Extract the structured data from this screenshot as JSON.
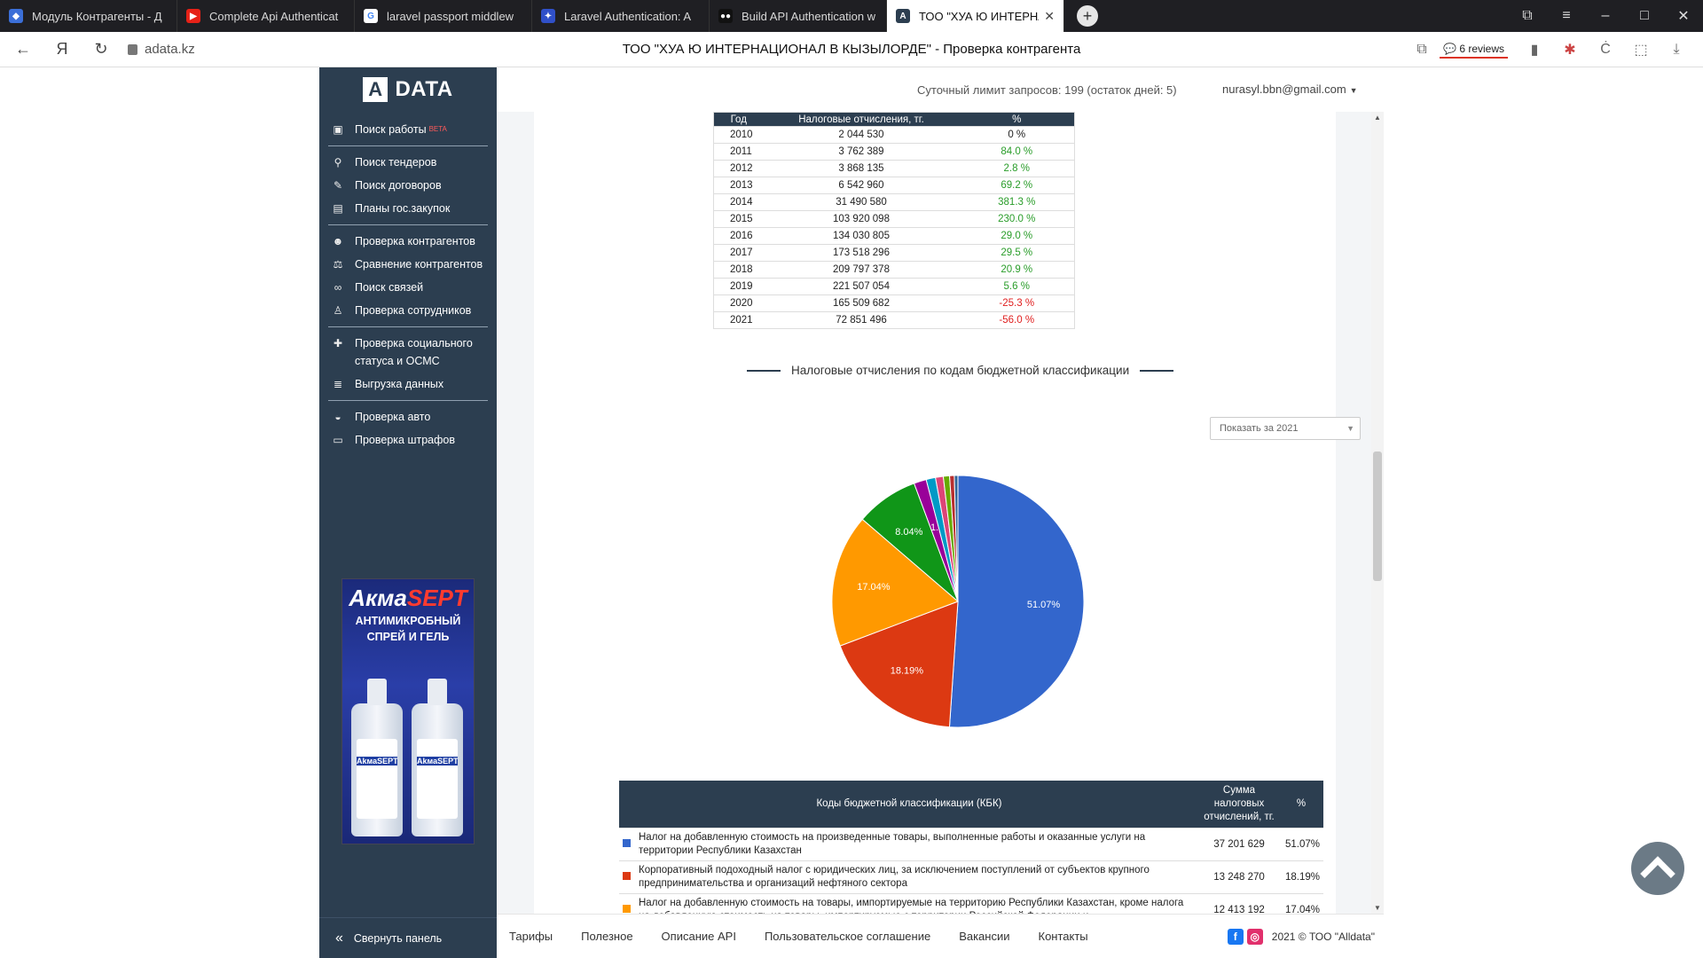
{
  "browser": {
    "tabs": [
      {
        "label": "Модуль Контрагенты - Д",
        "color": "#3b6fd8",
        "glyph": "◆"
      },
      {
        "label": "Complete Api Authenticat",
        "color": "#e62117",
        "glyph": "▶"
      },
      {
        "label": "laravel passport middlew",
        "color": "#ffffff",
        "glyph": "G"
      },
      {
        "label": "Laravel Authentication: A",
        "color": "#3050c8",
        "glyph": "✦"
      },
      {
        "label": "Build API Authentication w",
        "color": "#111111",
        "glyph": "●●"
      },
      {
        "label": "ТОО \"ХУА Ю ИНТЕРНА",
        "color": "#2c3e50",
        "glyph": "A"
      }
    ],
    "url": "adata.kz",
    "page_title": "ТОО \"ХУА Ю ИНТЕРНАЦИОНАЛ В КЫЗЫЛОРДЕ\" - Проверка контрагента",
    "reviews": "6 reviews"
  },
  "sidebar": {
    "logo": "DATA",
    "logo_mark": "A",
    "items": [
      {
        "label": "Поиск работы",
        "badge": "BETA",
        "icon": "briefcase-icon",
        "glyph": "▣"
      },
      {
        "label": "Поиск тендеров",
        "icon": "search-icon",
        "glyph": "⚲"
      },
      {
        "label": "Поиск договоров",
        "icon": "contract-icon",
        "glyph": "✎"
      },
      {
        "label": "Планы гос.закупок",
        "icon": "plan-icon",
        "glyph": "▤"
      },
      {
        "label": "Проверка контрагентов",
        "icon": "users-icon",
        "glyph": "☻"
      },
      {
        "label": "Сравнение контрагентов",
        "icon": "scales-icon",
        "glyph": "⚖"
      },
      {
        "label": "Поиск связей",
        "icon": "link-icon",
        "glyph": "∞"
      },
      {
        "label": "Проверка сотрудников",
        "icon": "employee-icon",
        "glyph": "♙"
      },
      {
        "label": "Проверка социального статуса и ОСМС",
        "icon": "plus-icon",
        "glyph": "✚"
      },
      {
        "label": "Выгрузка данных",
        "icon": "database-icon",
        "glyph": "≣"
      },
      {
        "label": "Проверка авто",
        "icon": "car-icon",
        "glyph": "◒"
      },
      {
        "label": "Проверка штрафов",
        "icon": "fine-icon",
        "glyph": "▭"
      }
    ],
    "ad": {
      "brand_a": "Акма",
      "brand_b": "SEPT",
      "line1": "АНТИМИКРОБНЫЙ",
      "line2": "СПРЕЙ И ГЕЛЬ"
    },
    "collapse": "Свернуть панель"
  },
  "header": {
    "limit": "Суточный лимит запросов: 199 (остаток дней: 5)",
    "user": "nurasyl.bbn@gmail.com"
  },
  "year_table": {
    "headers": [
      "Год",
      "Налоговые отчисления, тг.",
      "%"
    ],
    "rows": [
      {
        "year": "2010",
        "amount": "2 044 530",
        "pct": "0 %",
        "cls": "zero"
      },
      {
        "year": "2011",
        "amount": "3 762 389",
        "pct": "84.0 %",
        "cls": "pos"
      },
      {
        "year": "2012",
        "amount": "3 868 135",
        "pct": "2.8 %",
        "cls": "pos"
      },
      {
        "year": "2013",
        "amount": "6 542 960",
        "pct": "69.2 %",
        "cls": "pos"
      },
      {
        "year": "2014",
        "amount": "31 490 580",
        "pct": "381.3 %",
        "cls": "pos"
      },
      {
        "year": "2015",
        "amount": "103 920 098",
        "pct": "230.0 %",
        "cls": "pos"
      },
      {
        "year": "2016",
        "amount": "134 030 805",
        "pct": "29.0 %",
        "cls": "pos"
      },
      {
        "year": "2017",
        "amount": "173 518 296",
        "pct": "29.5 %",
        "cls": "pos"
      },
      {
        "year": "2018",
        "amount": "209 797 378",
        "pct": "20.9 %",
        "cls": "pos"
      },
      {
        "year": "2019",
        "amount": "221 507 054",
        "pct": "5.6 %",
        "cls": "pos"
      },
      {
        "year": "2020",
        "amount": "165 509 682",
        "pct": "-25.3 %",
        "cls": "neg"
      },
      {
        "year": "2021",
        "amount": "72 851 496",
        "pct": "-56.0 %",
        "cls": "neg"
      }
    ]
  },
  "kbk_section": {
    "title": "Налоговые отчисления по кодам бюджетной классификации",
    "select": "Показать за 2021"
  },
  "chart_data": {
    "type": "pie",
    "slices": [
      {
        "value": 51.07,
        "label": "51.07%",
        "color": "#3366cc"
      },
      {
        "value": 18.19,
        "label": "18.19%",
        "color": "#dc3912"
      },
      {
        "value": 17.04,
        "label": "17.04%",
        "color": "#ff9900"
      },
      {
        "value": 8.04,
        "label": "8.04%",
        "color": "#109618"
      },
      {
        "value": 1.6,
        "label": "1.",
        "color": "#990099"
      },
      {
        "value": 1.2,
        "label": "",
        "color": "#0099c6"
      },
      {
        "value": 1.0,
        "label": "",
        "color": "#dd4477"
      },
      {
        "value": 0.8,
        "label": "",
        "color": "#66aa00"
      },
      {
        "value": 0.6,
        "label": "",
        "color": "#b82e2e"
      },
      {
        "value": 0.46,
        "label": "",
        "color": "#316395"
      }
    ]
  },
  "kbk_table": {
    "headers": [
      "Коды бюджетной классификации (КБК)",
      "Сумма налоговых отчислений, тг.",
      "%"
    ],
    "rows": [
      {
        "color": "#3366cc",
        "name": "Налог на добавленную стоимость на произведенные товары, выполненные работы и оказанные услуги на территории Республики Казахстан",
        "sum": "37 201 629",
        "pct": "51.07%"
      },
      {
        "color": "#dc3912",
        "name": "Корпоративный подоходный налог с юридических лиц, за исключением поступлений от субъектов крупного предпринимательства и организаций нефтяного сектора",
        "sum": "13 248 270",
        "pct": "18.19%"
      },
      {
        "color": "#ff9900",
        "name": "Налог на добавленную стоимость на товары, импортируемые на территорию Республики Казахстан, кроме налога на добавленную стоимость на товары, импортируемые с территории Российской Федерации и",
        "sum": "12 413 192",
        "pct": "17.04%"
      }
    ]
  },
  "footer": {
    "links": [
      "Тарифы",
      "Полезное",
      "Описание API",
      "Пользовательское соглашение",
      "Вакансии",
      "Контакты"
    ],
    "copyright": "2021 © ТОО \"Alldata\""
  }
}
